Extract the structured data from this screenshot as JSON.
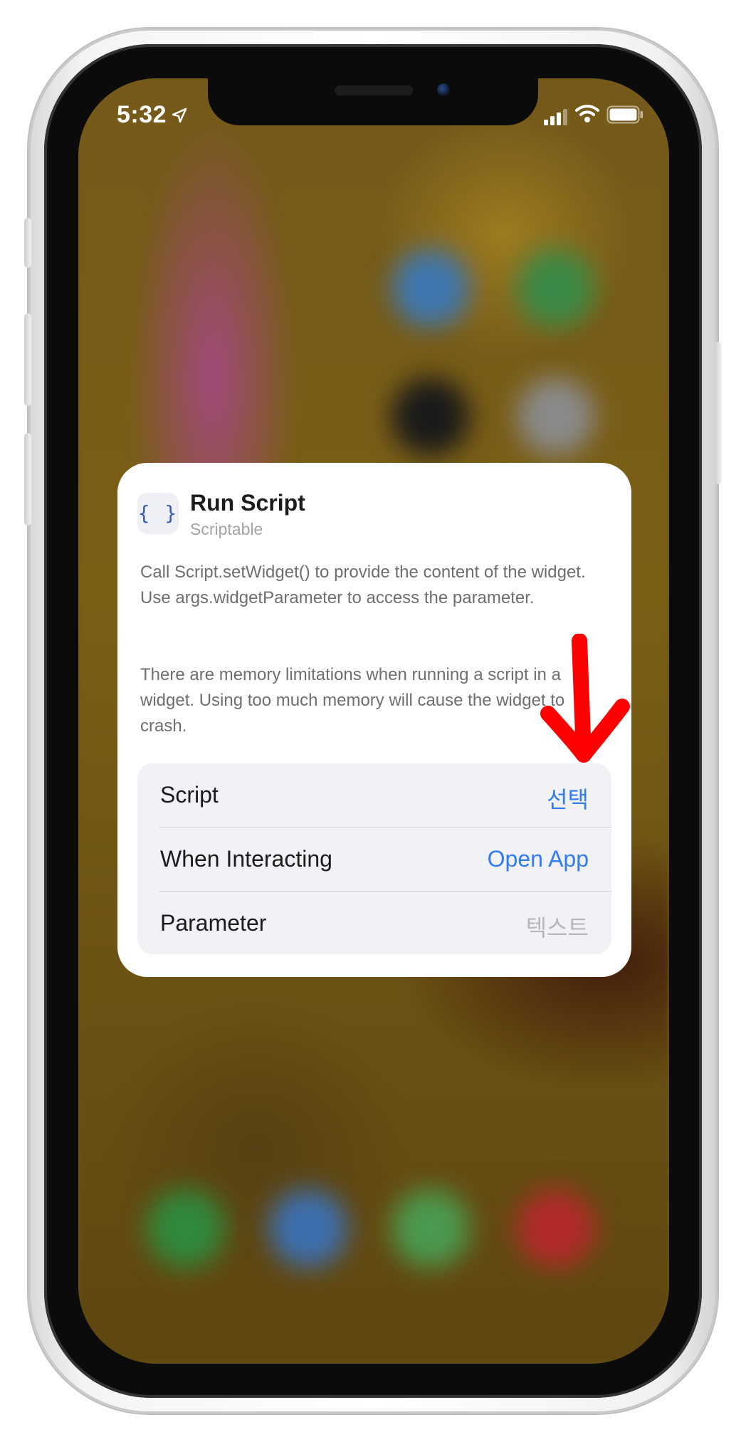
{
  "status_bar": {
    "time": "5:32",
    "icons": [
      "location-arrow-icon",
      "cellular-signal-icon",
      "wifi-icon",
      "battery-icon"
    ]
  },
  "widget": {
    "app_icon_glyph": "{ }",
    "title": "Run Script",
    "subtitle": "Scriptable",
    "description_1": "Call Script.setWidget() to provide the content of the widget. Use args.widgetParameter to access the parameter.",
    "description_2": "There are memory limitations when running a script in a widget. Using too much memory will cause the widget to crash.",
    "settings": [
      {
        "label": "Script",
        "value": "선택"
      },
      {
        "label": "When Interacting",
        "value": "Open App"
      },
      {
        "label": "Parameter",
        "value": "텍스트"
      }
    ]
  },
  "colors": {
    "accent": "#2F7CF6",
    "annotation_arrow": "#FF0000",
    "placeholder": "#B6B6BB"
  }
}
